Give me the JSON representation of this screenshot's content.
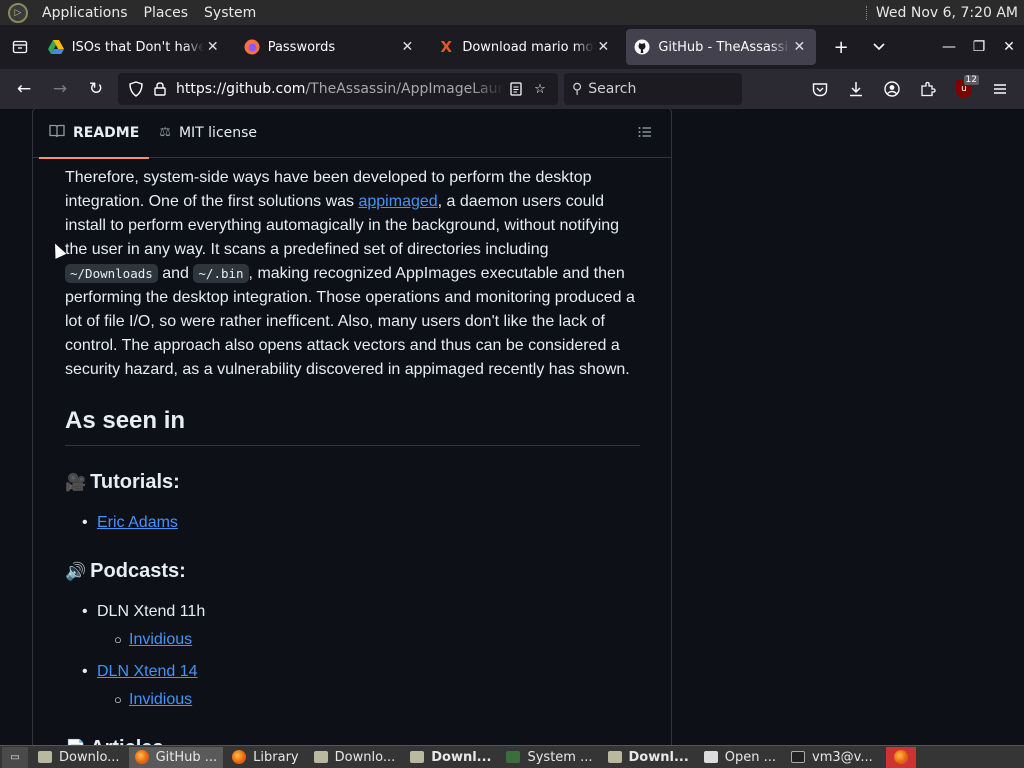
{
  "panel": {
    "menus": [
      "Applications",
      "Places",
      "System"
    ],
    "clock": "Wed Nov  6,  7:20 AM"
  },
  "tabs": [
    {
      "title": "ISOs that Don't haven't",
      "icon": "google-drive-icon",
      "active": false
    },
    {
      "title": "Passwords",
      "icon": "firefox-icon",
      "active": false
    },
    {
      "title": "Download mario movie",
      "icon": "x-favicon-icon",
      "active": false
    },
    {
      "title": "GitHub - TheAssassin/AppImageLauncher",
      "icon": "github-icon",
      "active": true
    }
  ],
  "nav": {
    "url_host": "https://github.com",
    "url_path": "/TheAssassin/AppImageLauncher",
    "search_placeholder": "Search",
    "extension_badge": "12"
  },
  "readme": {
    "tabs": [
      {
        "label": "README",
        "icon": "book-icon",
        "active": true
      },
      {
        "label": "MIT license",
        "icon": "scale-icon",
        "active": false
      }
    ],
    "para": {
      "t1": "Therefore, system-side ways have been developed to perform the desktop integration. One of the first solutions was ",
      "link": "appimaged",
      "t2": ", a daemon users could install to perform everything automagically in the background, without notifying the user in any way. It scans a predefined set of directories including ",
      "code1": "~/Downloads",
      "t3": " and ",
      "code2": "~/.bin",
      "t4": ", making recognized AppImages executable and then performing the desktop integration. Those operations and monitoring produced a lot of file I/O, so were rather inefficent. Also, many users don't like the lack of control. The approach also opens attack vectors and thus can be considered a security hazard, as a vulnerability discovered in appimaged recently has shown."
    },
    "as_seen_heading": "As seen in",
    "tutorials_heading": "Tutorials:",
    "tutorials_emoji": "🎥",
    "tutorials": [
      "Eric Adams"
    ],
    "podcasts_heading": "Podcasts:",
    "podcasts_emoji": "🔊",
    "podcast1": "DLN Xtend 11h",
    "podcast1_sub": "Invidious",
    "podcast2": "DLN Xtend 14",
    "podcast2_sub": "Invidious",
    "articles_heading": "Articles",
    "articles_emoji": "📄"
  },
  "taskbar": [
    {
      "label": "Downlo...",
      "icon": "folder",
      "active": false,
      "bold": false
    },
    {
      "label": "GitHub ...",
      "icon": "firefox",
      "active": true,
      "bold": false
    },
    {
      "label": "Library",
      "icon": "firefox",
      "active": false,
      "bold": false
    },
    {
      "label": "Downlo...",
      "icon": "folder",
      "active": false,
      "bold": false
    },
    {
      "label": "Downl...",
      "icon": "folder",
      "active": false,
      "bold": true
    },
    {
      "label": "System ...",
      "icon": "monitor",
      "active": false,
      "bold": false
    },
    {
      "label": "Downl...",
      "icon": "folder",
      "active": false,
      "bold": true
    },
    {
      "label": "Open ...",
      "icon": "document",
      "active": false,
      "bold": false
    },
    {
      "label": "vm3@v...",
      "icon": "terminal",
      "active": false,
      "bold": false
    }
  ]
}
